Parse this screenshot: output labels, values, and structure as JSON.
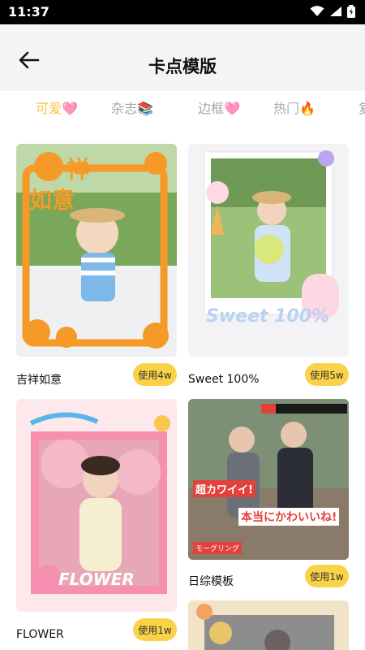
{
  "status": {
    "time": "11:37"
  },
  "header": {
    "title": "卡点模版"
  },
  "tabs": [
    {
      "label": "可爱🩷"
    },
    {
      "label": "杂志📚"
    },
    {
      "label": "边框🩷"
    },
    {
      "label": "热门🔥"
    },
    {
      "label": "复"
    }
  ],
  "cards": [
    {
      "name": "吉祥如意",
      "use": "使用4w",
      "thumb_text_1": "祥一",
      "thumb_text_2": "如意"
    },
    {
      "name": "Sweet 100%",
      "use": "使用5w",
      "thumb_text": "Sweet 100%"
    },
    {
      "name": "FLOWER",
      "use": "使用1w",
      "thumb_text": "FLOWER"
    },
    {
      "name": "日综模板",
      "use": "使用1w",
      "thumb_text_1": "超カワイイ!",
      "thumb_text_2": "本当にかわいいね!",
      "thumb_text_3": "モーグリング"
    }
  ]
}
